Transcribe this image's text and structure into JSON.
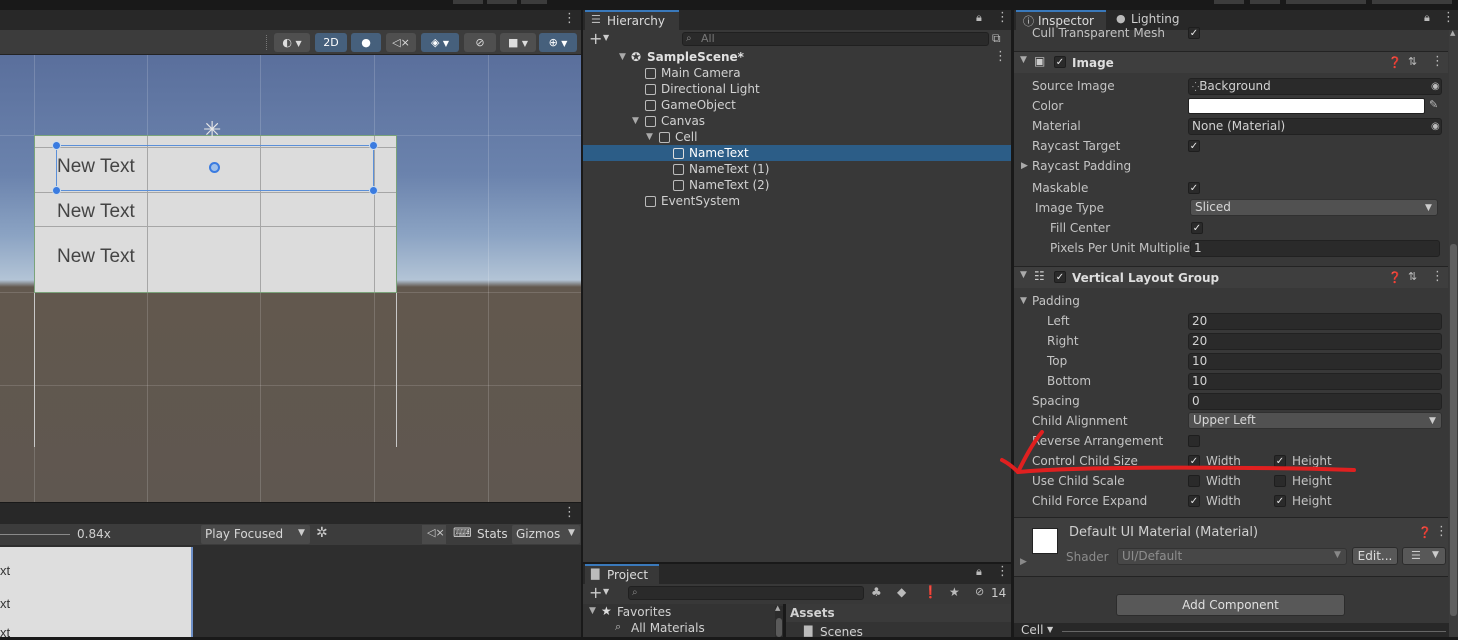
{
  "scene_toolbar": {
    "btn_2d": "2D"
  },
  "scene": {
    "canvas_texts": [
      "New Text",
      "New Text",
      "New Text"
    ]
  },
  "game_toolbar": {
    "scale_value": "0.84x",
    "play_mode": "Play Focused",
    "stats": "Stats",
    "gizmos": "Gizmos"
  },
  "game": {
    "texts": [
      "xt",
      "xt",
      "xt"
    ]
  },
  "hierarchy": {
    "tab": "Hierarchy",
    "search_placeholder": "All",
    "scene_name": "SampleScene*",
    "items": [
      "Main Camera",
      "Directional Light",
      "GameObject",
      "Canvas",
      "Cell",
      "NameText",
      "NameText (1)",
      "NameText (2)",
      "EventSystem"
    ]
  },
  "project": {
    "tab": "Project",
    "hidden_count": "14",
    "favorites": "Favorites",
    "all_materials": "All Materials",
    "assets": "Assets",
    "scenes": "Scenes"
  },
  "inspector": {
    "tab_inspector": "Inspector",
    "tab_lighting": "Lighting",
    "cull_transparent_mesh": "Cull Transparent Mesh",
    "image": {
      "title": "Image",
      "source_image_label": "Source Image",
      "source_image_value": "Background",
      "color_label": "Color",
      "material_label": "Material",
      "material_value": "None (Material)",
      "raycast_target_label": "Raycast Target",
      "raycast_padding_label": "Raycast Padding",
      "maskable_label": "Maskable",
      "image_type_label": "Image Type",
      "image_type_value": "Sliced",
      "fill_center_label": "Fill Center",
      "ppu_label": "Pixels Per Unit Multiplier",
      "ppu_value": "1"
    },
    "vlg": {
      "title": "Vertical Layout Group",
      "padding_label": "Padding",
      "left_label": "Left",
      "left_value": "20",
      "right_label": "Right",
      "right_value": "20",
      "top_label": "Top",
      "top_value": "10",
      "bottom_label": "Bottom",
      "bottom_value": "10",
      "spacing_label": "Spacing",
      "spacing_value": "0",
      "child_alignment_label": "Child Alignment",
      "child_alignment_value": "Upper Left",
      "reverse_label": "Reverse Arrangement",
      "control_child_size_label": "Control Child Size",
      "use_child_scale_label": "Use Child Scale",
      "child_force_expand_label": "Child Force Expand",
      "width": "Width",
      "height": "Height"
    },
    "material": {
      "title": "Default UI Material (Material)",
      "shader_label": "Shader",
      "shader_value": "UI/Default",
      "edit_label": "Edit..."
    },
    "add_component": "Add Component",
    "preview_label": "Cell"
  },
  "colors": {
    "selection": "#2c5d87",
    "accent_tab": "#3a79bb",
    "annotation": "#e02020"
  }
}
